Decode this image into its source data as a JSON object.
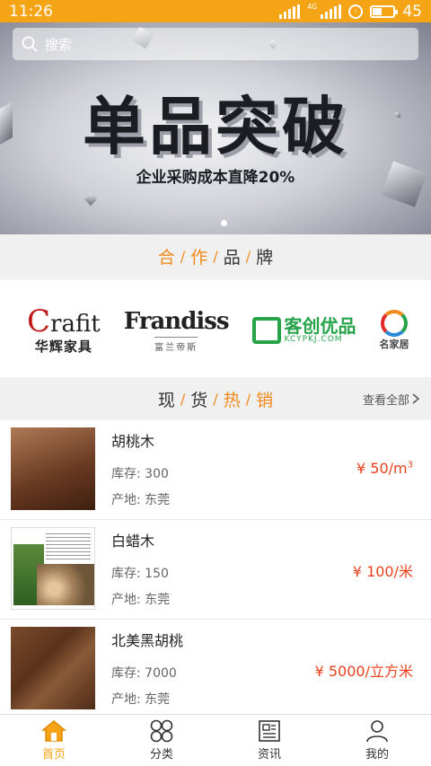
{
  "status_bar": {
    "time": "11:26",
    "network": "4G",
    "battery": "45"
  },
  "search": {
    "placeholder": "搜索"
  },
  "banner": {
    "headline": "单品突破",
    "subline": "企业采购成本直降20%",
    "slide_count": 2,
    "active_slide": 2
  },
  "brands_section": {
    "chars": [
      "合",
      "作",
      "品",
      "牌"
    ]
  },
  "brands": [
    {
      "name_en": "rafit",
      "initial": "C",
      "name_zh": "华辉家具"
    },
    {
      "name_en": "Frandiss",
      "name_zh": "富兰帝斯"
    },
    {
      "name_zh": "客创优品",
      "url": "KCYPKJ.COM"
    },
    {
      "name_zh": "名家居"
    }
  ],
  "hot_section": {
    "chars": [
      "现",
      "货",
      "热",
      "销"
    ],
    "view_all": "查看全部"
  },
  "products": [
    {
      "name": "胡桃木",
      "stock_label": "库存:",
      "stock": "300",
      "origin_label": "产地:",
      "origin": "东莞",
      "price": "¥ 50/m",
      "price_sup": "3"
    },
    {
      "name": "白蜡木",
      "stock_label": "库存:",
      "stock": "150",
      "origin_label": "产地:",
      "origin": "东莞",
      "price": "¥ 100/米",
      "price_sup": ""
    },
    {
      "name": "北美黑胡桃",
      "stock_label": "库存:",
      "stock": "7000",
      "origin_label": "产地:",
      "origin": "东莞",
      "price": "¥ 5000/立方米",
      "price_sup": ""
    }
  ],
  "tabs": [
    {
      "label": "首页",
      "icon": "home-icon",
      "active": true
    },
    {
      "label": "分类",
      "icon": "category-icon",
      "active": false
    },
    {
      "label": "资讯",
      "icon": "news-icon",
      "active": false
    },
    {
      "label": "我的",
      "icon": "user-icon",
      "active": false
    }
  ],
  "colors": {
    "accent": "#f5a416",
    "price": "#e8411f",
    "highlight": "#f08a1a"
  }
}
